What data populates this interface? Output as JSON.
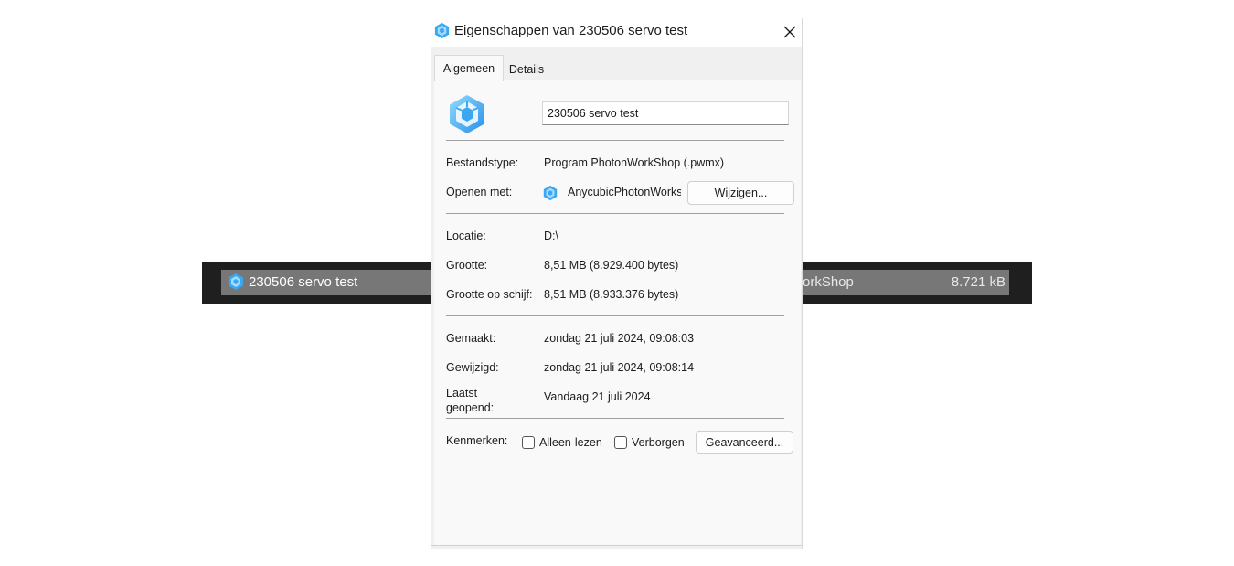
{
  "colors": {
    "accent": "#3aa7f0",
    "icon_light": "#7fd0ff",
    "explorer_bg": "#1f1f1f",
    "explorer_row": "#777777"
  },
  "explorer": {
    "file_name": "230506 servo test",
    "file_type_partial": "orkShop",
    "file_size": "8.721 kB",
    "icon": "anycubic-file-icon"
  },
  "dialog": {
    "title": "Eigenschappen van 230506 servo test",
    "tabs": [
      {
        "label": "Algemeen",
        "active": true
      },
      {
        "label": "Details",
        "active": false
      }
    ],
    "general": {
      "file_name_value": "230506 servo test",
      "file_type_label": "Bestandstype:",
      "file_type_value": "Program PhotonWorkShop (.pwmx)",
      "open_with_label": "Openen met:",
      "open_with_value": "AnycubicPhotonWorkshop",
      "change_button": "Wijzigen...",
      "location_label": "Locatie:",
      "location_value": "D:\\",
      "size_label": "Grootte:",
      "size_value": "8,51 MB (8.929.400 bytes)",
      "size_on_disk_label": "Grootte op schijf:",
      "size_on_disk_value": "8,51 MB (8.933.376 bytes)",
      "created_label": "Gemaakt:",
      "created_value": "zondag 21 juli 2024, 09:08:03",
      "modified_label": "Gewijzigd:",
      "modified_value": "zondag 21 juli 2024, 09:08:14",
      "accessed_label_line1": "Laatst",
      "accessed_label_line2": "geopend:",
      "accessed_value": "Vandaag 21 juli 2024",
      "attributes_label": "Kenmerken:",
      "readonly_label": "Alleen-lezen",
      "hidden_label": "Verborgen",
      "advanced_button": "Geavanceerd..."
    }
  }
}
